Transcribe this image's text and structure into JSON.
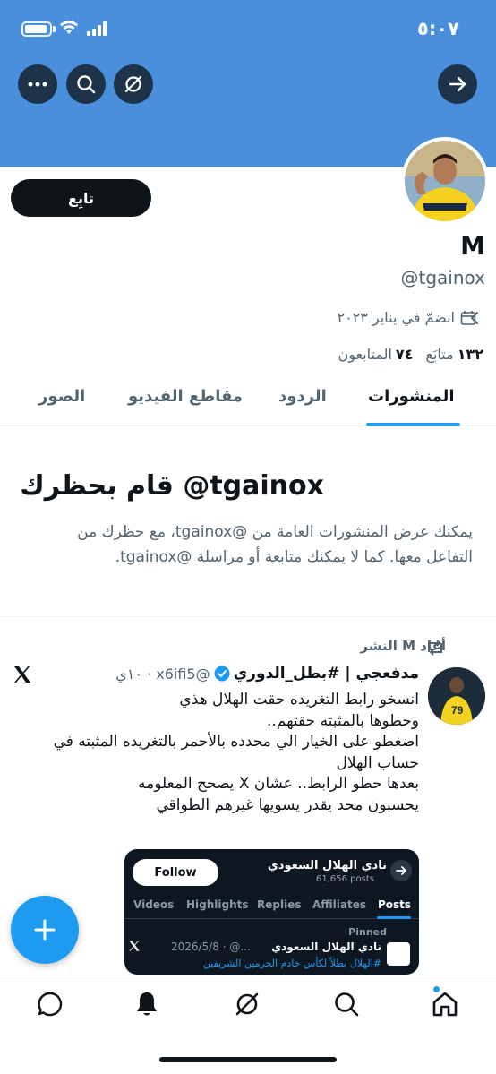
{
  "status_bar": {
    "time": "٥:٠٧"
  },
  "header_buttons": {
    "back": "arrow-right-icon",
    "grok": "grok-icon",
    "search": "search-icon",
    "more": "more-icon"
  },
  "profile": {
    "follow_label": "تابِع",
    "name": "M",
    "handle": "@tgainox",
    "joined": "انضمّ في يناير ٢٠٢٣",
    "following_count": "١٣٢",
    "following_label": "متابَع",
    "followers_count": "٧٤",
    "followers_label": "المتابعون"
  },
  "tabs": [
    {
      "label": "المنشورات",
      "active": true
    },
    {
      "label": "الردود",
      "active": false
    },
    {
      "label": "مقاطع الفيديو",
      "active": false
    },
    {
      "label": "الصور",
      "active": false
    }
  ],
  "blocked": {
    "title": "قام بحظرك @tgainox",
    "body": "يمكنك عرض المنشورات العامة من @tgainox، مع حظرك من التفاعل معها. كما لا يمكنك متابعة أو مراسلة @tgainox."
  },
  "tweet": {
    "repost_label": "أعاد M النشر",
    "display_name": "مدفعجي | #بطل_الدوري",
    "meta": "@x6ifi5 · ١٠ي",
    "lines": [
      "انسخو رابط التغريده حقت الهلال هذي",
      "وحطوها بالمثبته حقتهم..",
      "اضغطو على الخيار الي محدده بالأحمر  بالتغريده المثبته في حساب الهلال",
      "بعدها حطو الرابط.. عشان X يصحح المعلومه",
      "يحسبون محد يقدر يسويها غيرهم الطواقي"
    ],
    "media": {
      "follow_label": "Follow",
      "club_name": "نادي الهلال السعودي",
      "posts_count": "61,656 posts",
      "tabs": [
        "Videos",
        "Highlights",
        "Replies",
        "Affiliates",
        "Posts"
      ],
      "pinned_label": "Pinned",
      "inner_name": "نادي الهلال السعودي",
      "inner_date": "2026/5/8 · @...",
      "inner_line": "#الهلال بطلاً لكأس خادم الحرمين الشريفين"
    }
  },
  "bottom_nav": [
    "home-icon",
    "search-icon",
    "grok-icon",
    "notifications-icon",
    "messages-icon"
  ],
  "colors": {
    "banner": "#4a8fdc",
    "accent": "#1d9bf0",
    "text": "#0f1419",
    "muted": "#536471"
  }
}
